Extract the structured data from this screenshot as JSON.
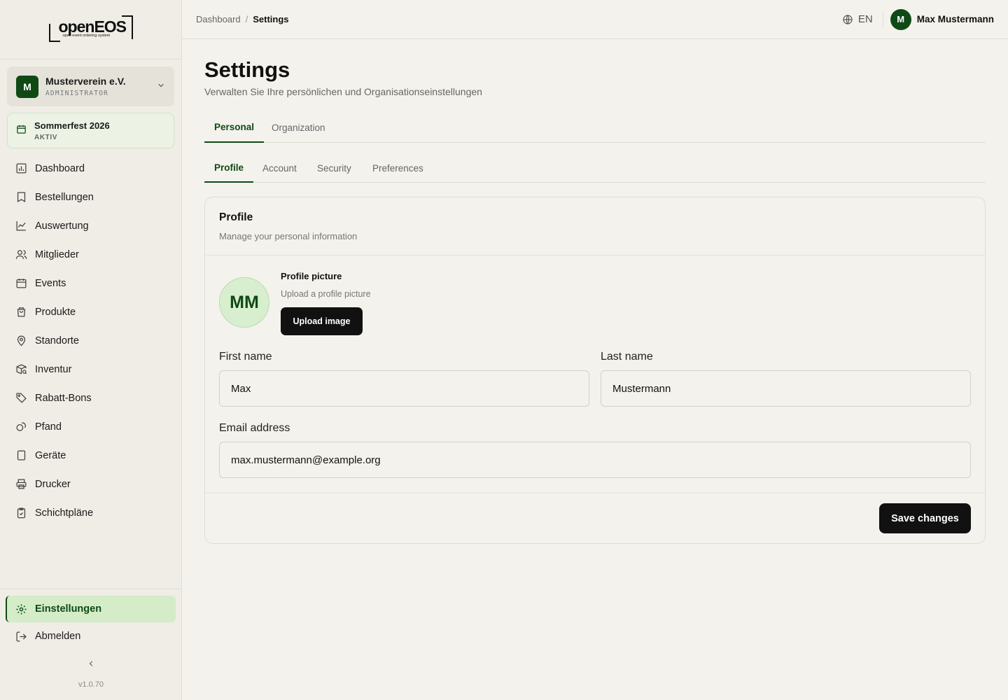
{
  "brand": {
    "logo_word": "openEOS",
    "logo_tagline": "open event ordering system"
  },
  "organization": {
    "initial": "M",
    "name": "Musterverein e.V.",
    "role": "ADMINISTRATOR"
  },
  "event": {
    "name": "Sommerfest 2026",
    "status": "AKTIV"
  },
  "sidebar": {
    "items": [
      {
        "label": "Dashboard",
        "icon": "dashboard-icon"
      },
      {
        "label": "Bestellungen",
        "icon": "receipt-icon"
      },
      {
        "label": "Auswertung",
        "icon": "chart-line-icon"
      },
      {
        "label": "Mitglieder",
        "icon": "users-icon"
      },
      {
        "label": "Events",
        "icon": "calendar-icon"
      },
      {
        "label": "Produkte",
        "icon": "shopping-bag-icon"
      },
      {
        "label": "Standorte",
        "icon": "map-pin-icon"
      },
      {
        "label": "Inventur",
        "icon": "package-search-icon"
      },
      {
        "label": "Rabatt-Bons",
        "icon": "tag-icon"
      },
      {
        "label": "Pfand",
        "icon": "coins-icon"
      },
      {
        "label": "Geräte",
        "icon": "tablet-icon"
      },
      {
        "label": "Drucker",
        "icon": "printer-icon"
      },
      {
        "label": "Schichtpläne",
        "icon": "clipboard-check-icon"
      }
    ],
    "settings_label": "Einstellungen",
    "logout_label": "Abmelden",
    "version": "v1.0.70"
  },
  "header": {
    "breadcrumb_root": "Dashboard",
    "breadcrumb_sep": "/",
    "breadcrumb_current": "Settings",
    "language": "EN",
    "user_initial": "M",
    "user_name": "Max Mustermann"
  },
  "page": {
    "title": "Settings",
    "subtitle": "Verwalten Sie Ihre persönlichen und Organisationseinstellungen",
    "tabs": [
      "Personal",
      "Organization"
    ],
    "subtabs": [
      "Profile",
      "Account",
      "Security",
      "Preferences"
    ]
  },
  "profile_card": {
    "title": "Profile",
    "description": "Manage your personal information",
    "avatar_initials": "MM",
    "picture_title": "Profile picture",
    "picture_desc": "Upload a profile picture",
    "upload_label": "Upload image",
    "first_name_label": "First name",
    "first_name_value": "Max",
    "last_name_label": "Last name",
    "last_name_value": "Mustermann",
    "email_label": "Email address",
    "email_value": "max.mustermann@example.org",
    "save_label": "Save changes"
  },
  "colors": {
    "accent": "#0f4a15",
    "background": "#f4f2ec",
    "active_nav_bg": "#d4ecc8"
  }
}
